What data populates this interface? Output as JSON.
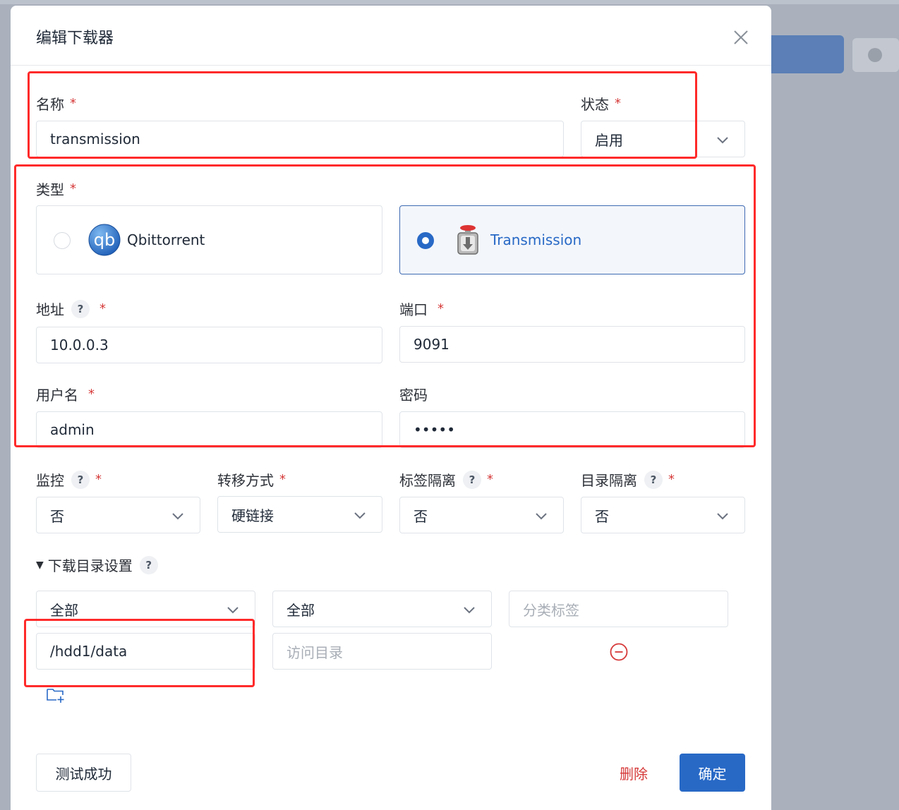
{
  "dialog": {
    "title": "编辑下载器"
  },
  "fields": {
    "name": {
      "label": "名称",
      "value": "transmission"
    },
    "status": {
      "label": "状态",
      "value": "启用"
    },
    "type": {
      "label": "类型",
      "options": [
        {
          "label": "Qbittorrent",
          "icon": "qbittorrent-logo",
          "selected": false
        },
        {
          "label": "Transmission",
          "icon": "transmission-logo",
          "selected": true
        }
      ]
    },
    "host": {
      "label": "地址",
      "value": "10.0.0.3"
    },
    "port": {
      "label": "端口",
      "value": "9091"
    },
    "username": {
      "label": "用户名",
      "value": "admin"
    },
    "password": {
      "label": "密码",
      "value": "•••••"
    },
    "monitor": {
      "label": "监控",
      "value": "否"
    },
    "transfer": {
      "label": "转移方式",
      "value": "硬链接"
    },
    "tag_isolation": {
      "label": "标签隔离",
      "value": "否"
    },
    "dir_isolation": {
      "label": "目录隔离",
      "value": "否"
    }
  },
  "download_dirs": {
    "label": "下载目录设置",
    "media_type": "全部",
    "category": "全部",
    "tag_placeholder": "分类标签",
    "save_path": "/hdd1/data",
    "access_placeholder": "访问目录"
  },
  "common": {
    "required": "*",
    "help": "?"
  },
  "footer": {
    "test_label": "测试成功",
    "delete_label": "删除",
    "ok_label": "确定"
  },
  "colors": {
    "primary": "#2869c6",
    "danger": "#d63939",
    "annotation": "#ff2a2a"
  }
}
